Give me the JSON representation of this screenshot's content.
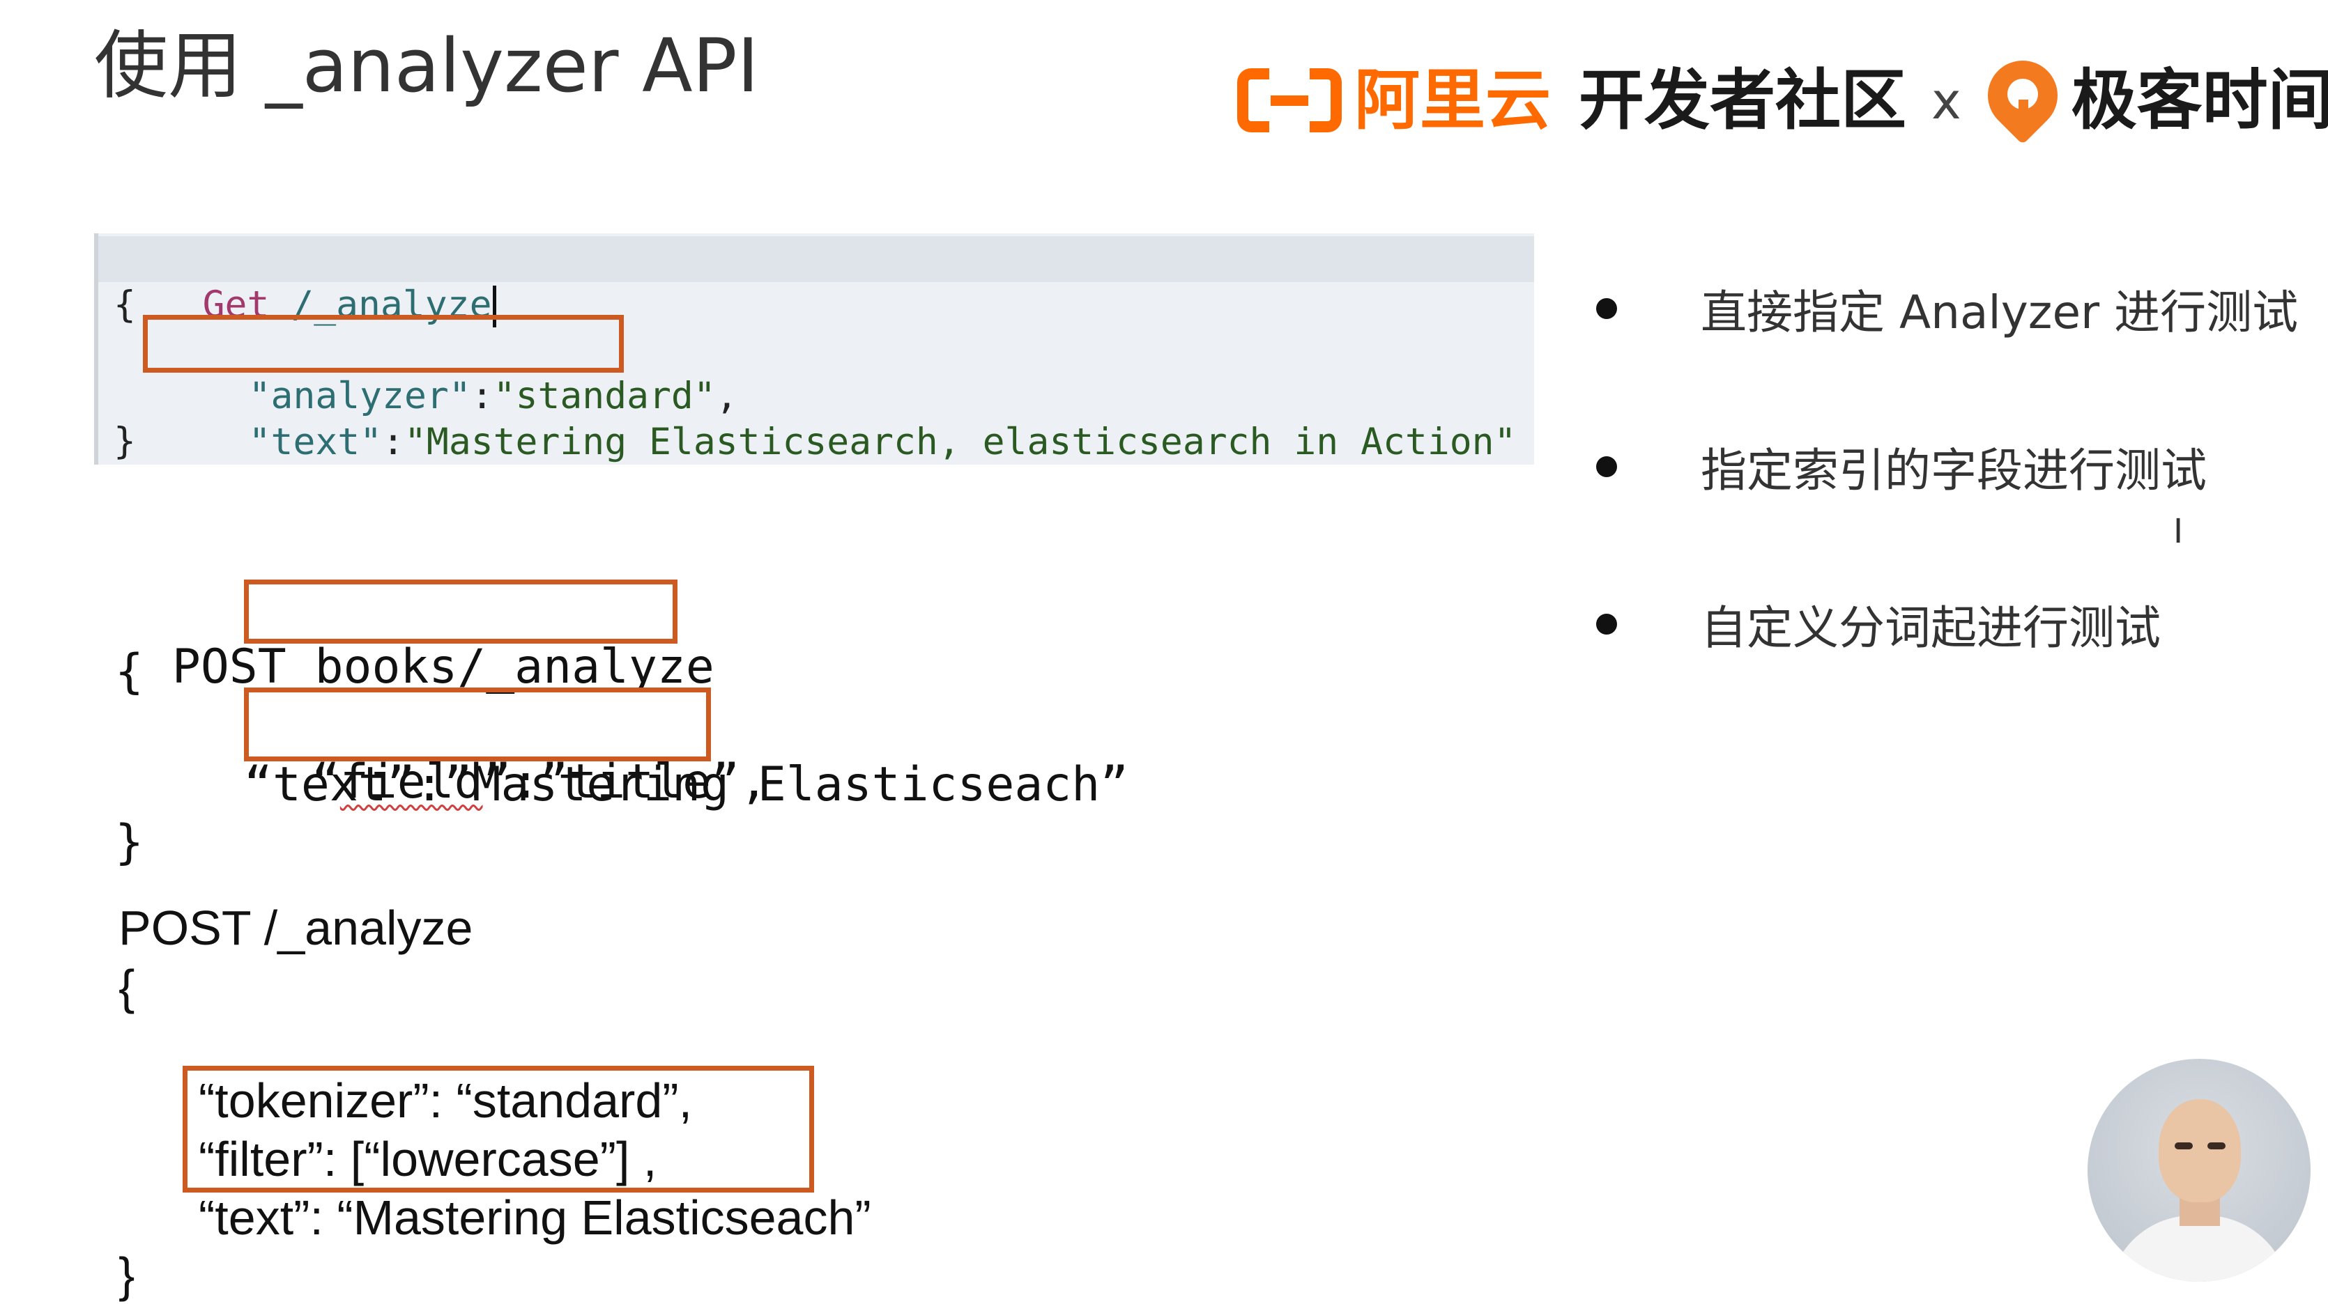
{
  "slide": {
    "title": "使用 _analyzer API"
  },
  "branding": {
    "aliyun": "阿里云",
    "community": "开发者社区",
    "cross": "x",
    "geek": "极客时间"
  },
  "colors": {
    "highlight_box": "#cd5a20",
    "aliyun_orange": "#ff6a00",
    "code_bg": "#edf0f5"
  },
  "example_console": {
    "method": "Get",
    "path": "/_analyze",
    "open_brace": "{",
    "analyzer_key": "\"analyzer\"",
    "colon1": ":",
    "analyzer_value": "\"standard\"",
    "comma1": ",",
    "text_key": "\"text\"",
    "colon2": ":",
    "text_value": "\"Mastering Elasticsearch, elasticsearch in Action\"",
    "close_brace": "}"
  },
  "example_field": {
    "method": "POST",
    "path": "books/_analyze",
    "open_brace": "{",
    "field_open": "“",
    "field_key": "field",
    "field_rest": "”:”title”,",
    "text_line": "“text”:”Mastering Elasticseach”",
    "close_brace": "}"
  },
  "example_custom": {
    "request": "POST /_analyze",
    "open_brace": "{",
    "tokenizer_line": "“tokenizer”: “standard”,",
    "filter_line": "“filter”: [“lowercase”] ,",
    "text_line": "“text”: “Mastering Elasticseach”",
    "close_brace": "}"
  },
  "bullets": [
    "直接指定 Analyzer 进行测试",
    "指定索引的字段进行测试",
    "自定义分词起进行测试"
  ],
  "icons": {
    "text_cursor": "I"
  }
}
